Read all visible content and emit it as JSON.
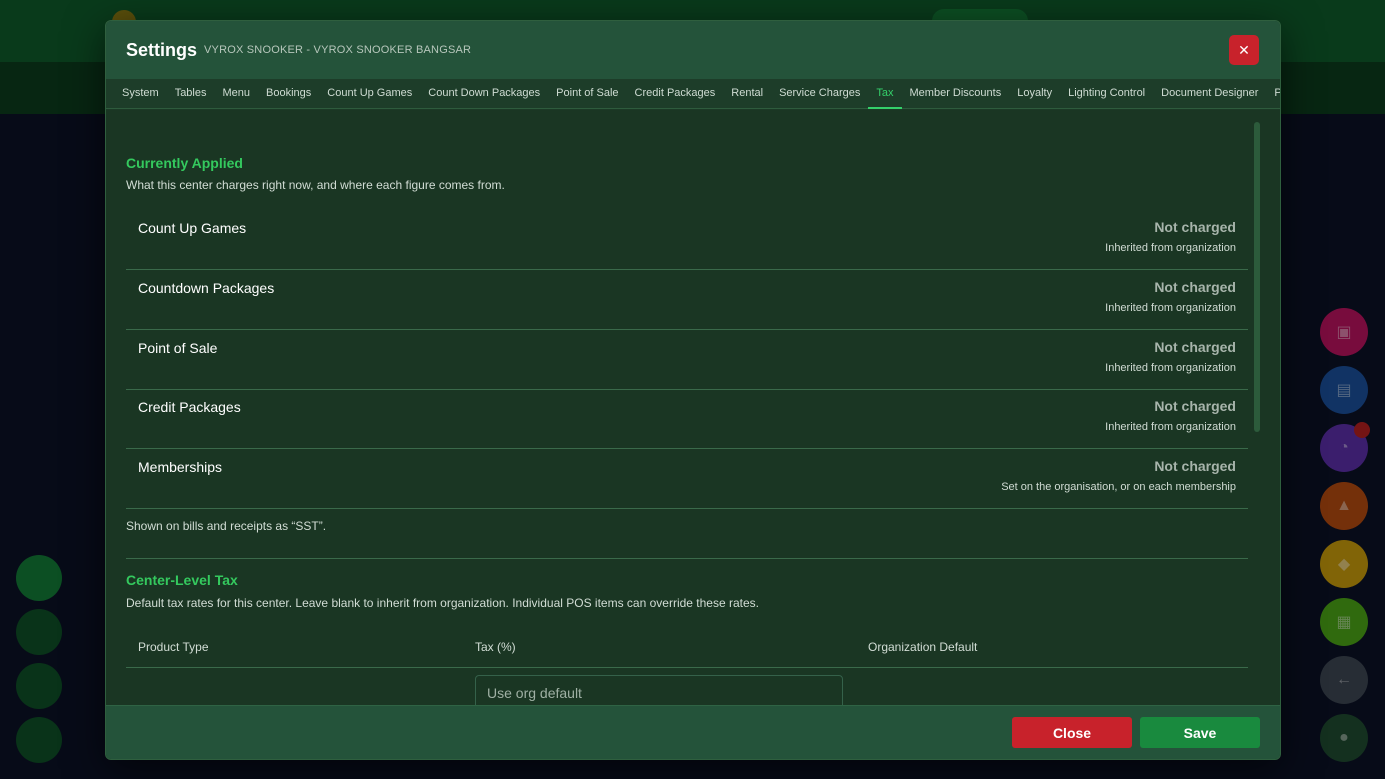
{
  "modal": {
    "title": "Settings",
    "subtitle": "VYROX SNOOKER - VYROX SNOOKER BANGSAR",
    "close_icon_glyph": "✕"
  },
  "tabs": [
    {
      "label": "System"
    },
    {
      "label": "Tables"
    },
    {
      "label": "Menu"
    },
    {
      "label": "Bookings"
    },
    {
      "label": "Count Up Games"
    },
    {
      "label": "Count Down Packages"
    },
    {
      "label": "Point of Sale"
    },
    {
      "label": "Credit Packages"
    },
    {
      "label": "Rental"
    },
    {
      "label": "Service Charges"
    },
    {
      "label": "Tax",
      "active": true
    },
    {
      "label": "Member Discounts"
    },
    {
      "label": "Loyalty"
    },
    {
      "label": "Lighting Control"
    },
    {
      "label": "Document Designer"
    },
    {
      "label": "Printers"
    }
  ],
  "applied": {
    "title": "Currently Applied",
    "description": "What this center charges right now, and where each figure comes from.",
    "rows": [
      {
        "label": "Count Up Games",
        "value": "Not charged",
        "source": "Inherited from organization"
      },
      {
        "label": "Countdown Packages",
        "value": "Not charged",
        "source": "Inherited from organization"
      },
      {
        "label": "Point of Sale",
        "value": "Not charged",
        "source": "Inherited from organization"
      },
      {
        "label": "Credit Packages",
        "value": "Not charged",
        "source": "Inherited from organization"
      },
      {
        "label": "Memberships",
        "value": "Not charged",
        "source": "Set on the organisation, or on each membership"
      }
    ],
    "note": "Shown on bills and receipts as “SST”."
  },
  "center_tax": {
    "title": "Center-Level Tax",
    "description": "Default tax rates for this center. Leave blank to inherit from organization. Individual POS items can override these rates.",
    "headers": {
      "product_type": "Product Type",
      "tax": "Tax (%)",
      "org_default": "Organization Default"
    },
    "input_placeholder": "Use org default"
  },
  "footer": {
    "close_label": "Close",
    "save_label": "Save"
  },
  "colors": {
    "accent": "#34d06a",
    "danger": "#c8222b",
    "primary": "#198a3e"
  }
}
